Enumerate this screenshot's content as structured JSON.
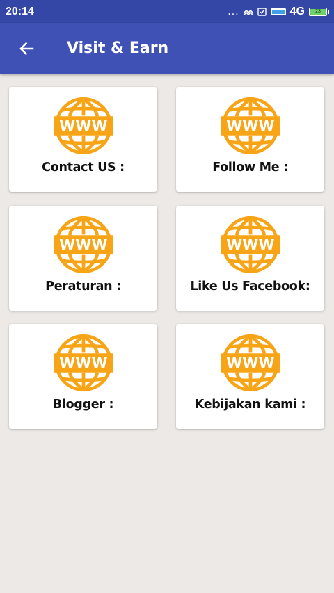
{
  "status_bar": {
    "time": "20:14",
    "dots": "...",
    "network": "4G",
    "battery_level": "23"
  },
  "app_bar": {
    "title": "Visit & Earn",
    "back_icon": "arrow-back-icon"
  },
  "cards": [
    {
      "label": "Contact US :",
      "icon": "www-globe-icon"
    },
    {
      "label": "Follow Me :",
      "icon": "www-globe-icon"
    },
    {
      "label": "Peraturan :",
      "icon": "www-globe-icon"
    },
    {
      "label": "Like Us Facebook:",
      "icon": "www-globe-icon"
    },
    {
      "label": "Blogger :",
      "icon": "www-globe-icon"
    },
    {
      "label": "Kebijakan kami :",
      "icon": "www-globe-icon"
    }
  ],
  "colors": {
    "status_bar": "#3447a6",
    "app_bar": "#3f51b5",
    "globe": "#f7a416",
    "background": "#ece9e6"
  }
}
